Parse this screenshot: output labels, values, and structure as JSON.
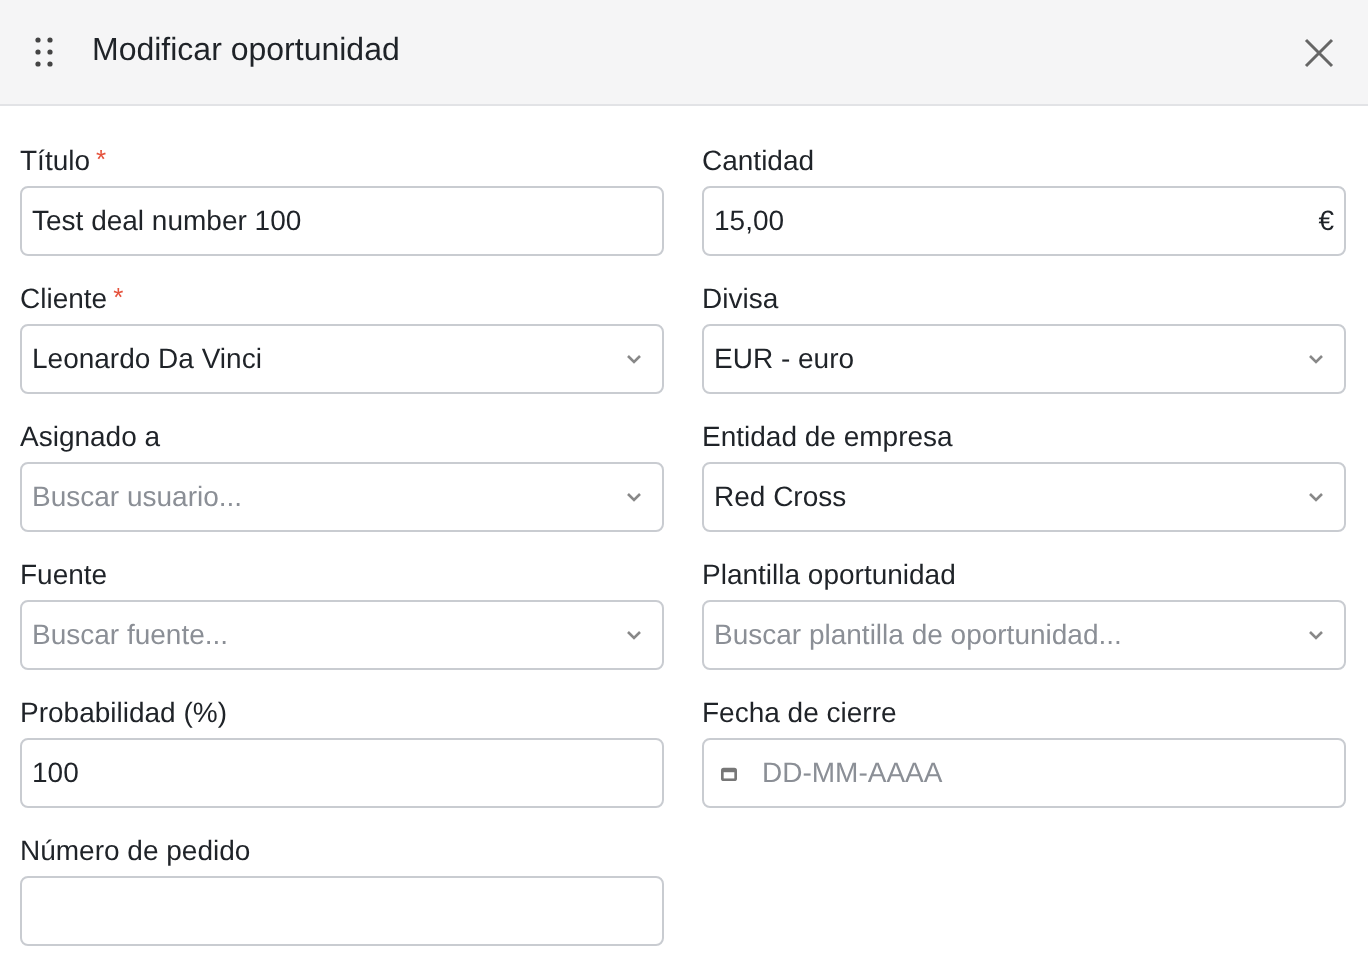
{
  "dialog": {
    "title": "Modificar oportunidad"
  },
  "fields": [
    {
      "label": "Título",
      "required_mark": "*",
      "kind": "text",
      "value": "Test deal number 100"
    },
    {
      "label": "Cantidad",
      "kind": "amount",
      "value": "15,00",
      "suffix": "€"
    },
    {
      "label": "Cliente",
      "required_mark": "*",
      "kind": "select",
      "value": "Leonardo Da Vinci"
    },
    {
      "label": "Divisa",
      "kind": "select",
      "value": "EUR - euro"
    },
    {
      "label": "Asignado a",
      "kind": "select",
      "placeholder": "Buscar usuario..."
    },
    {
      "label": "Entidad de empresa",
      "kind": "select",
      "value": "Red Cross"
    },
    {
      "label": "Fuente",
      "kind": "select",
      "placeholder": "Buscar fuente..."
    },
    {
      "label": "Plantilla oportunidad",
      "kind": "select",
      "placeholder": "Buscar plantilla de oportunidad..."
    },
    {
      "label": "Probabilidad (%)",
      "kind": "text",
      "value": "100"
    },
    {
      "label": "Fecha de cierre",
      "kind": "date",
      "placeholder": "DD-MM-AAAA"
    },
    {
      "label": "Número de pedido",
      "kind": "text"
    }
  ]
}
